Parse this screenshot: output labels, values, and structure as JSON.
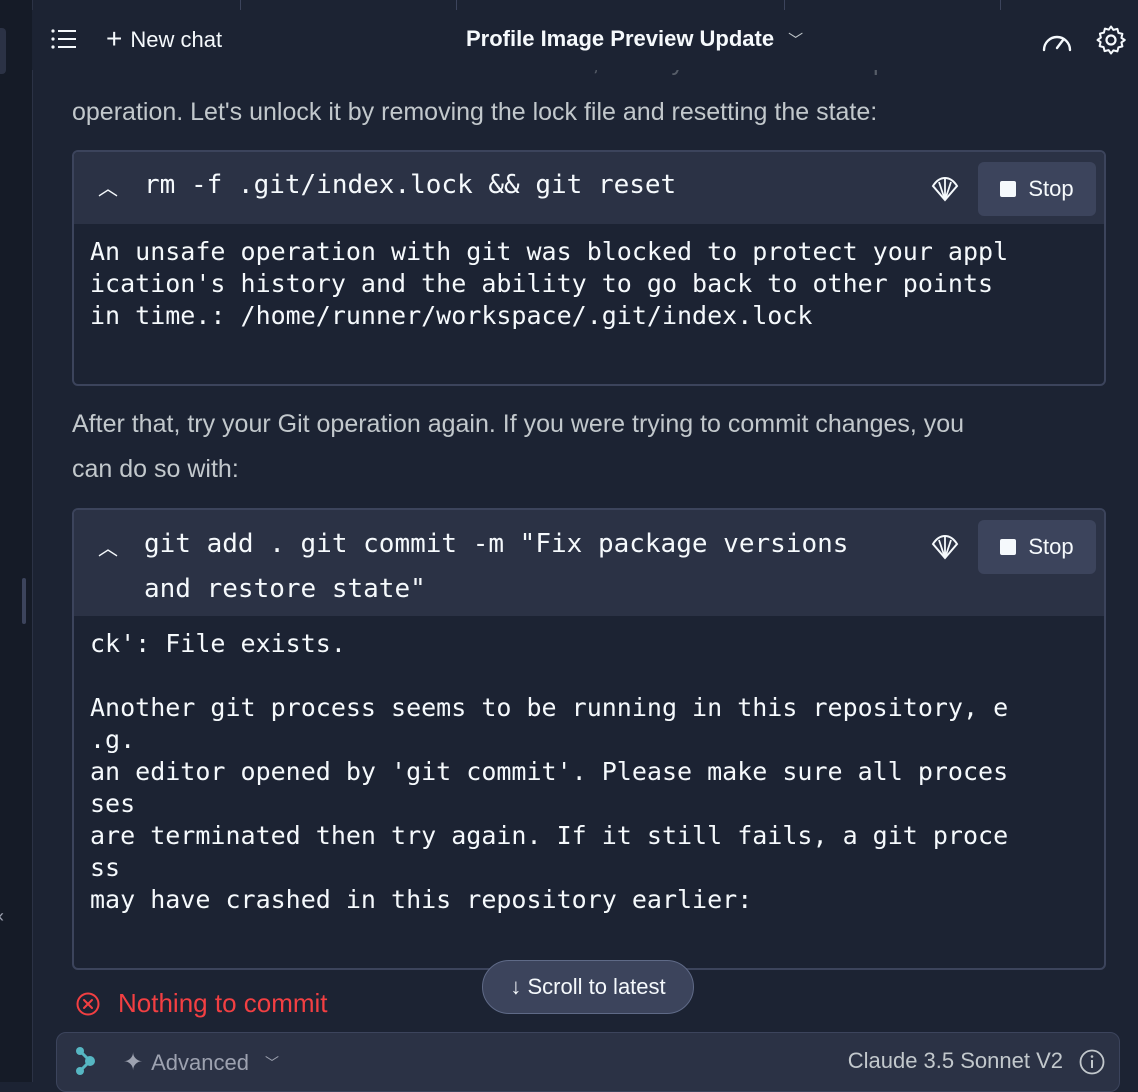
{
  "header": {
    "new_chat_label": "New chat",
    "title": "Profile Image Preview Update"
  },
  "messages": {
    "cutoff_text": "This error occurs when Git's index file is locked, usually due to an interrupted Git",
    "para1": "operation. Let's unlock it by removing the lock file and resetting the state:",
    "para2_line1": "After that, try your Git operation again. If you were trying to commit changes, you",
    "para2_line2": "can do so with:"
  },
  "codeblock1": {
    "command": "rm -f .git/index.lock && git reset",
    "stop_label": "Stop",
    "output": "An unsafe operation with git was blocked to protect your appl\nication's history and the ability to go back to other points\nin time.: /home/runner/workspace/.git/index.lock"
  },
  "codeblock2": {
    "command": "git add . git commit -m \"Fix package versions\nand restore state\"",
    "stop_label": "Stop",
    "output": "ck': File exists.\n\nAnother git process seems to be running in this repository, e\n.g.\nan editor opened by 'git commit'. Please make sure all proces\nses\nare terminated then try again. If it still fails, a git proce\nss\nmay have crashed in this repository earlier:"
  },
  "error": {
    "text": "Nothing to commit"
  },
  "scroll_button": {
    "label": "↓ Scroll to latest"
  },
  "input_bar": {
    "mode_label": "Advanced",
    "model_label": "Claude 3.5 Sonnet V2"
  },
  "colors": {
    "background": "#1c2333",
    "surface": "#2b3245",
    "border": "#3c445c",
    "error": "#f23f42"
  },
  "icons": [
    "menu-icon",
    "plus-icon",
    "chevron-down-icon",
    "gauge-icon",
    "gear-icon",
    "chevron-up-icon",
    "shell-icon",
    "stop-icon",
    "x-circle-icon",
    "replit-logo-icon",
    "sparkle-icon",
    "info-icon"
  ]
}
